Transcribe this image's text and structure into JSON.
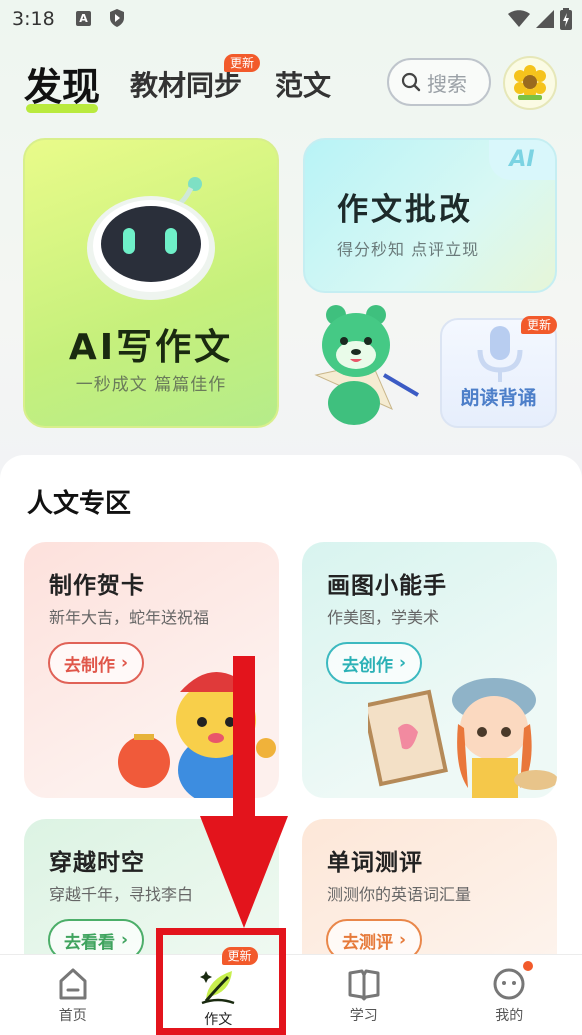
{
  "status_bar": {
    "time": "3:18",
    "a_icon": "A"
  },
  "header": {
    "tabs": [
      {
        "label": "发现",
        "active": true
      },
      {
        "label": "教材同步",
        "badge": "更新"
      },
      {
        "label": "范文"
      }
    ],
    "search_placeholder": "搜索"
  },
  "top_cards": {
    "ai_write": {
      "title": "AI写作文",
      "subtitle": "一秒成文 篇篇佳作"
    },
    "correction": {
      "title": "作文批改",
      "subtitle": "得分秒知 点评立现",
      "tag": "AI"
    },
    "recite": {
      "label": "朗读背诵",
      "badge": "更新"
    }
  },
  "section": {
    "title": "人文专区",
    "features": [
      {
        "title": "制作贺卡",
        "subtitle": "新年大吉，蛇年送祝福",
        "button": "去制作"
      },
      {
        "title": "画图小能手",
        "subtitle": "作美图，学美术",
        "button": "去创作"
      },
      {
        "title": "穿越时空",
        "subtitle": "穿越千年，寻找李白",
        "button": "去看看"
      },
      {
        "title": "单词测评",
        "subtitle": "测测你的英语词汇量",
        "button": "去测评"
      }
    ]
  },
  "bottom_nav": [
    {
      "label": "首页",
      "icon": "home-icon"
    },
    {
      "label": "作文",
      "icon": "pen-leaf-icon",
      "badge": "更新",
      "active": true
    },
    {
      "label": "学习",
      "icon": "book-icon"
    },
    {
      "label": "我的",
      "icon": "profile-face-icon",
      "dot": true
    }
  ],
  "colors": {
    "accent_green": "#b9ea3e",
    "badge_orange": "#f25a2b",
    "annotation_red": "#e3141c"
  }
}
